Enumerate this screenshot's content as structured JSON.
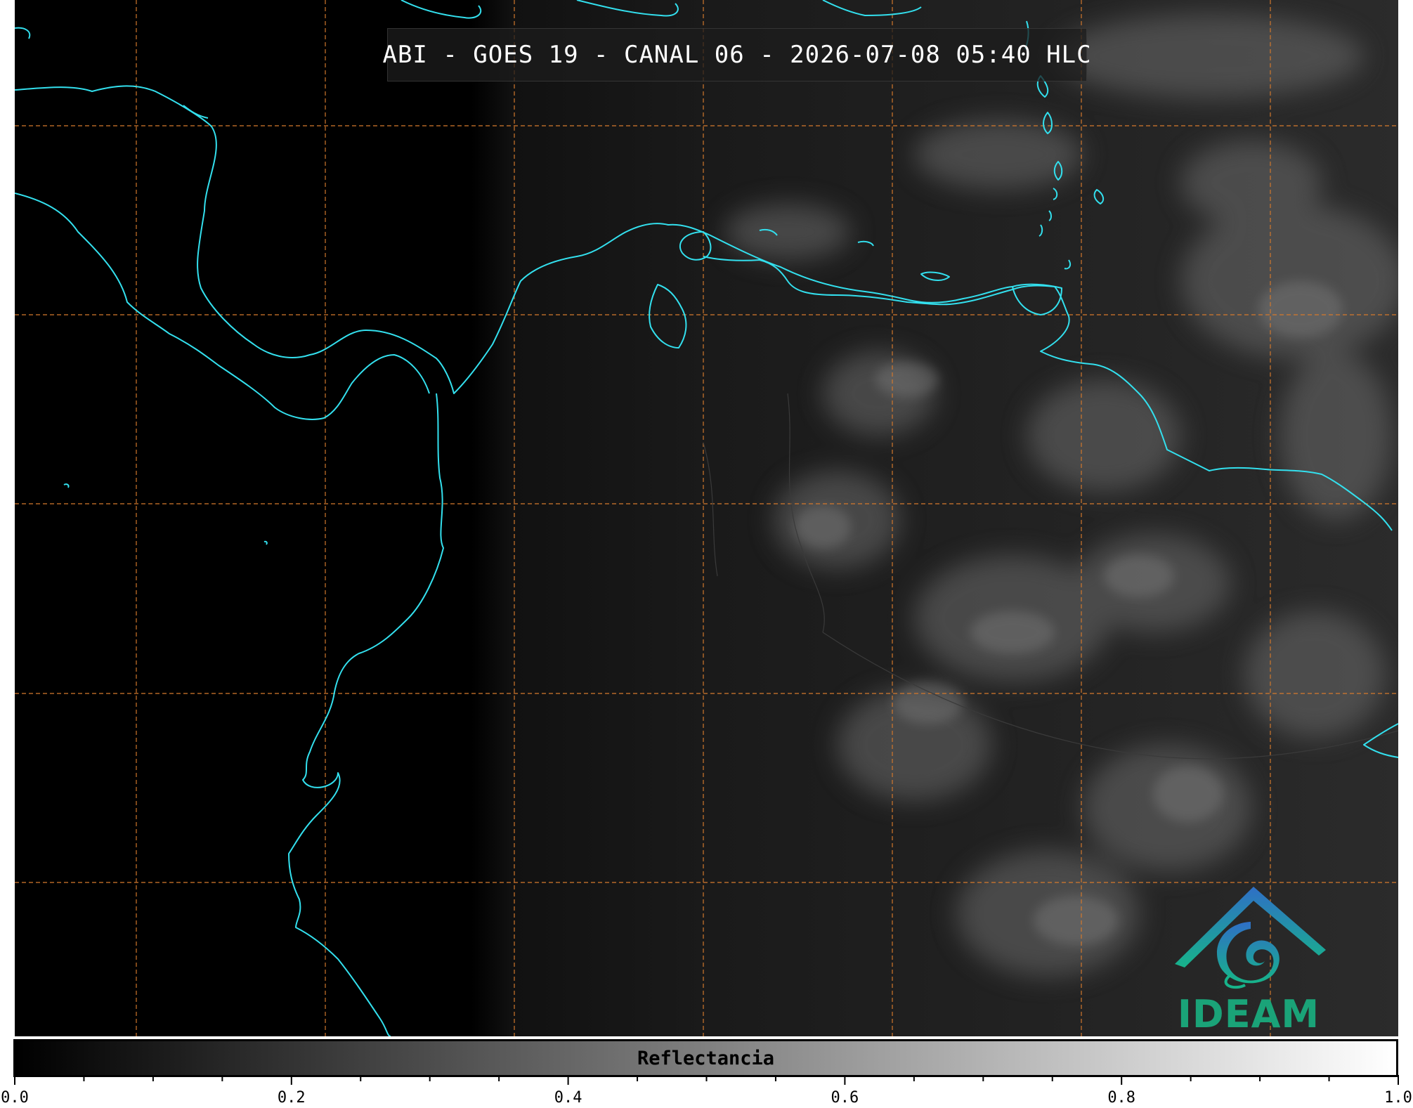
{
  "title": "ABI - GOES 19 - CANAL 06 - 2026-07-08 05:40 HLC",
  "logo": {
    "text": "IDEAM",
    "icon": "ideam-logo-icon",
    "color": "#1aa378"
  },
  "colorbar": {
    "label": "Reflectancia",
    "min": 0.0,
    "max": 1.0,
    "colormap": "gray",
    "tick_labels": [
      "0.0",
      "0.2",
      "0.4",
      "0.6",
      "0.8",
      "1.0"
    ],
    "minor_tick_step": 0.05
  },
  "map": {
    "coastline_color": "#33e0ee",
    "grid_color": "#d2782d",
    "grid_style": "dashed",
    "background": "#000000"
  }
}
